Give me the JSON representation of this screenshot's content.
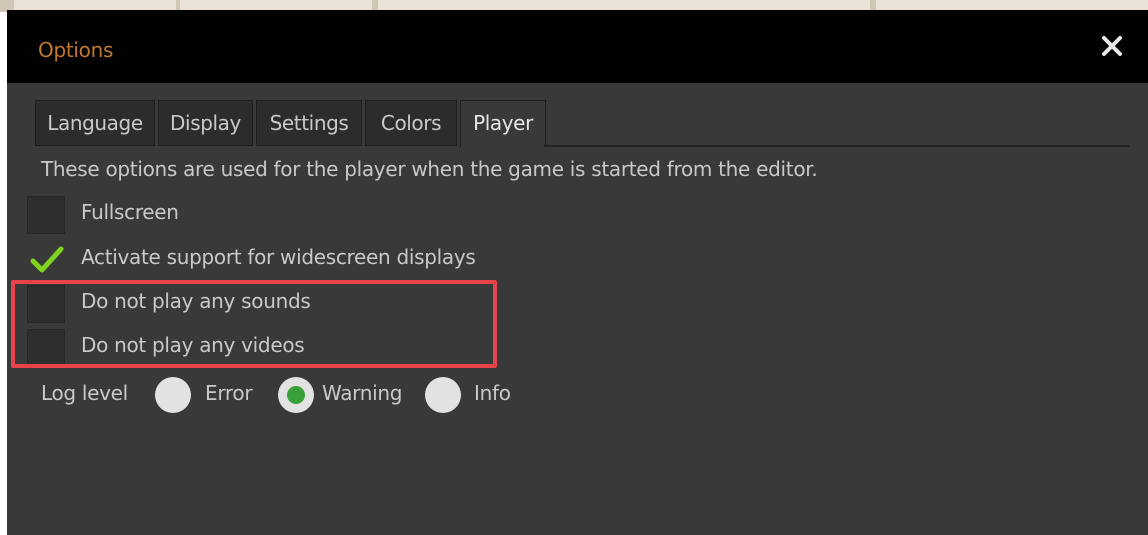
{
  "window": {
    "title": "Options",
    "close_symbol": "✕"
  },
  "tabs": [
    {
      "label": "Language",
      "active": false
    },
    {
      "label": "Display",
      "active": false
    },
    {
      "label": "Settings",
      "active": false
    },
    {
      "label": "Colors",
      "active": false
    },
    {
      "label": "Player",
      "active": true
    }
  ],
  "description": "These options are used for the player when the game is started from the editor.",
  "options": [
    {
      "label": "Fullscreen",
      "checked": false
    },
    {
      "label": "Activate support for widescreen displays",
      "checked": true
    },
    {
      "label": "Do not play any sounds",
      "checked": false
    },
    {
      "label": "Do not play any videos",
      "checked": false
    }
  ],
  "log_level": {
    "label": "Log level",
    "choices": [
      {
        "label": "Error",
        "selected": false
      },
      {
        "label": "Warning",
        "selected": true
      },
      {
        "label": "Info",
        "selected": false
      }
    ]
  },
  "colors": {
    "title": "#c07a2a",
    "checkmark": "#7ed321",
    "radio_selected": "#3aa23a",
    "highlight": "#e8424a"
  }
}
